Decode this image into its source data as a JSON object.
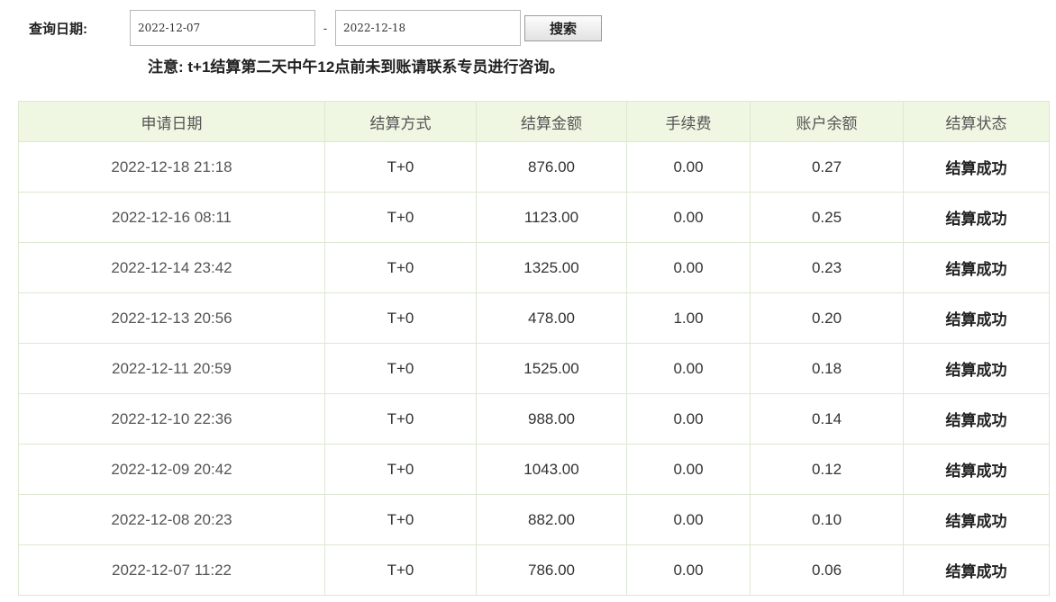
{
  "query": {
    "label": "查询日期:",
    "start_date": "2022-12-07",
    "separator": "-",
    "end_date": "2022-12-18",
    "search_label": "搜索"
  },
  "notice": "注意: t+1结算第二天中午12点前未到账请联系专员进行咨询。",
  "table": {
    "headers": [
      "申请日期",
      "结算方式",
      "结算金额",
      "手续费",
      "账户余额",
      "结算状态"
    ],
    "rows": [
      [
        "2022-12-18 21:18",
        "T+0",
        "876.00",
        "0.00",
        "0.27",
        "结算成功"
      ],
      [
        "2022-12-16 08:11",
        "T+0",
        "1123.00",
        "0.00",
        "0.25",
        "结算成功"
      ],
      [
        "2022-12-14 23:42",
        "T+0",
        "1325.00",
        "0.00",
        "0.23",
        "结算成功"
      ],
      [
        "2022-12-13 20:56",
        "T+0",
        "478.00",
        "1.00",
        "0.20",
        "结算成功"
      ],
      [
        "2022-12-11 20:59",
        "T+0",
        "1525.00",
        "0.00",
        "0.18",
        "结算成功"
      ],
      [
        "2022-12-10 22:36",
        "T+0",
        "988.00",
        "0.00",
        "0.14",
        "结算成功"
      ],
      [
        "2022-12-09 20:42",
        "T+0",
        "1043.00",
        "0.00",
        "0.12",
        "结算成功"
      ],
      [
        "2022-12-08 20:23",
        "T+0",
        "882.00",
        "0.00",
        "0.10",
        "结算成功"
      ],
      [
        "2022-12-07 11:22",
        "T+0",
        "786.00",
        "0.00",
        "0.06",
        "结算成功"
      ]
    ]
  },
  "colors": {
    "header_bg": "#eff7e3",
    "border": "#dde7d2"
  }
}
